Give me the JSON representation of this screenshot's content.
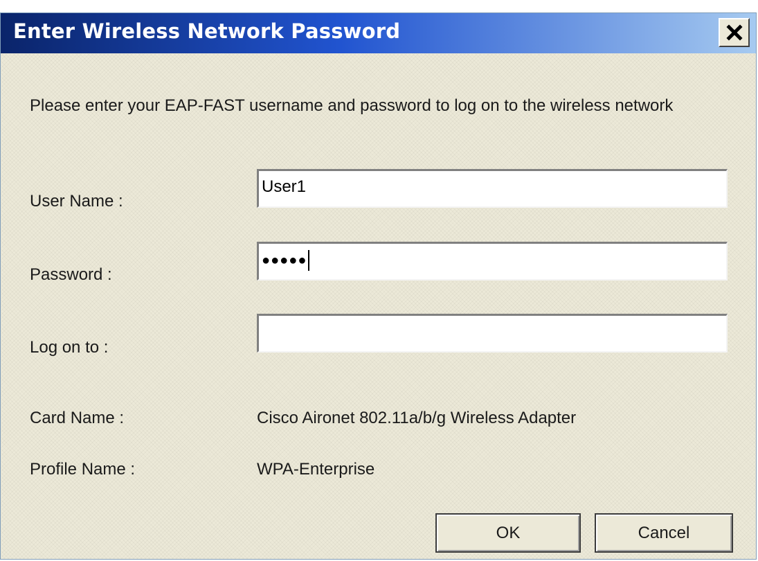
{
  "window": {
    "title": "Enter Wireless Network Password",
    "close_icon": "close-icon"
  },
  "prompt": "Please enter your EAP-FAST username and password to log on to the wireless network",
  "form": {
    "username_label": "User Name :",
    "username_value": "User1",
    "password_label": "Password :",
    "password_masked": "●●●●●",
    "logon_label": "Log on to :",
    "logon_value": ""
  },
  "info": {
    "card_label": "Card Name :",
    "card_value": "Cisco Aironet 802.11a/b/g Wireless Adapter",
    "profile_label": "Profile Name :",
    "profile_value": "WPA-Enterprise"
  },
  "buttons": {
    "ok_label": "OK",
    "cancel_label": "Cancel"
  },
  "colors": {
    "titlebar_start": "#0a246a",
    "titlebar_end": "#a6caf0",
    "dialog_background": "#ece9d8"
  }
}
